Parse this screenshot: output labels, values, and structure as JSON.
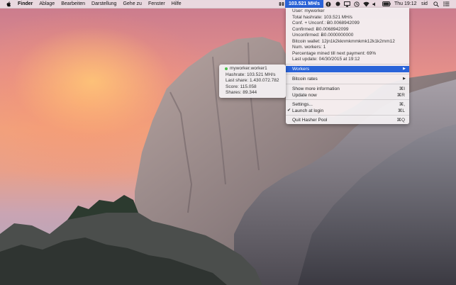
{
  "menubar": {
    "app_name": "Finder",
    "items": [
      "Ablage",
      "Bearbeiten",
      "Darstellung",
      "Gehe zu",
      "Fenster",
      "Hilfe"
    ],
    "status_hashrate": "103.521 MH/s",
    "clock": "Thu 19:12",
    "user": "sid"
  },
  "menu": {
    "info": [
      "User: myworker",
      "Total hashrate: 103.521 MH/s",
      "Conf. + Unconf.: Ƀ0.0068942099",
      "Confirmed: Ƀ0.0068942099",
      "Unconfirmed: Ƀ0.0000000000",
      "Bitcoin wallet: 12jn1k2kknmkmmkmk12k1k2mm12",
      "Num. workers: 1",
      "Percentage mined till next payment: 69%",
      "Last update: 04/30/2015 at 19:12"
    ],
    "workers_label": "Workers",
    "bitcoin_rates_label": "Bitcoin rates",
    "show_more_label": "Show more information",
    "show_more_shortcut": "⌘I",
    "update_now_label": "Update now",
    "update_now_shortcut": "⌘R",
    "settings_label": "Settings...",
    "settings_shortcut": "⌘,",
    "launch_login_label": "Launch at login",
    "launch_login_shortcut": "⌘L",
    "launch_login_checked": true,
    "quit_label": "Quit Hasher Pool",
    "quit_shortcut": "⌘Q"
  },
  "worker_submenu": {
    "name": "myworker.worker1",
    "hashrate": "Hashrate: 103.521 MH/s",
    "last_share": "Last share: 1.430.072.782",
    "score": "Score: 115.058",
    "shares": "Shares: 89.344"
  },
  "colors": {
    "highlight": "#2a63d8",
    "worker_status": "#4cc04c"
  }
}
